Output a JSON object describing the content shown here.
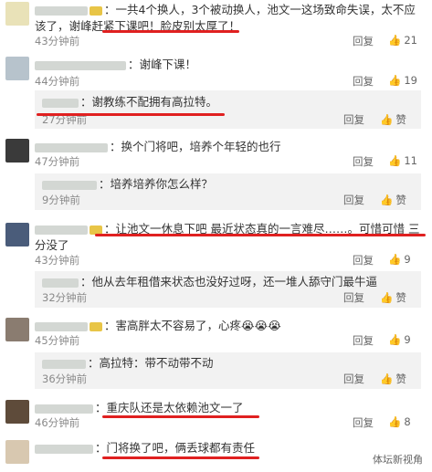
{
  "ui": {
    "reply_label": "回复",
    "like_icon": "thumbs-up-icon",
    "accent": "#e02020"
  },
  "comments": [
    {
      "text": "：一共4个换人，3个被动换人，池文一这场致命失误，太不应该了，谢峰赶紧下课吧！脸皮别太厚了！",
      "time": "43分钟前",
      "reply": "回复",
      "likes": "21"
    },
    {
      "text": "：谢峰下课！",
      "time": "44分钟前",
      "reply": "回复",
      "likes": "19"
    },
    {
      "text": "：谢教练不配拥有高拉特。",
      "time": "27分钟前",
      "reply": "回复",
      "likes": "赞",
      "sub": true
    },
    {
      "text": "：换个门将吧，培养个年轻的也行",
      "time": "47分钟前",
      "reply": "回复",
      "likes": "11"
    },
    {
      "text": "：培养培养你怎么样？",
      "time": "9分钟前",
      "reply": "回复",
      "likes": "赞",
      "sub": true
    },
    {
      "text": "：让池文一休息下吧 最近状态真的一言难尽……。可惜可惜 三分没了",
      "time": "43分钟前",
      "reply": "回复",
      "likes": "9"
    },
    {
      "text": "：他从去年租借来状态也没好过呀，还一堆人舔守门最牛逼",
      "time": "32分钟前",
      "reply": "回复",
      "likes": "赞",
      "sub": true
    },
    {
      "text": "：害高胖太不容易了，心疼😭😭😭",
      "time": "45分钟前",
      "reply": "回复",
      "likes": "9"
    },
    {
      "text": "：高拉特：带不动带不动",
      "time": "36分钟前",
      "reply": "回复",
      "likes": "赞",
      "sub": true
    },
    {
      "text": "：重庆队还是太依赖池文一了",
      "time": "46分钟前",
      "reply": "回复",
      "likes": "8"
    },
    {
      "text": "：门将换了吧，俩丢球都有责任",
      "time": "",
      "reply": "",
      "likes": "",
      "cut": true
    }
  ],
  "watermark": "体坛新视角"
}
